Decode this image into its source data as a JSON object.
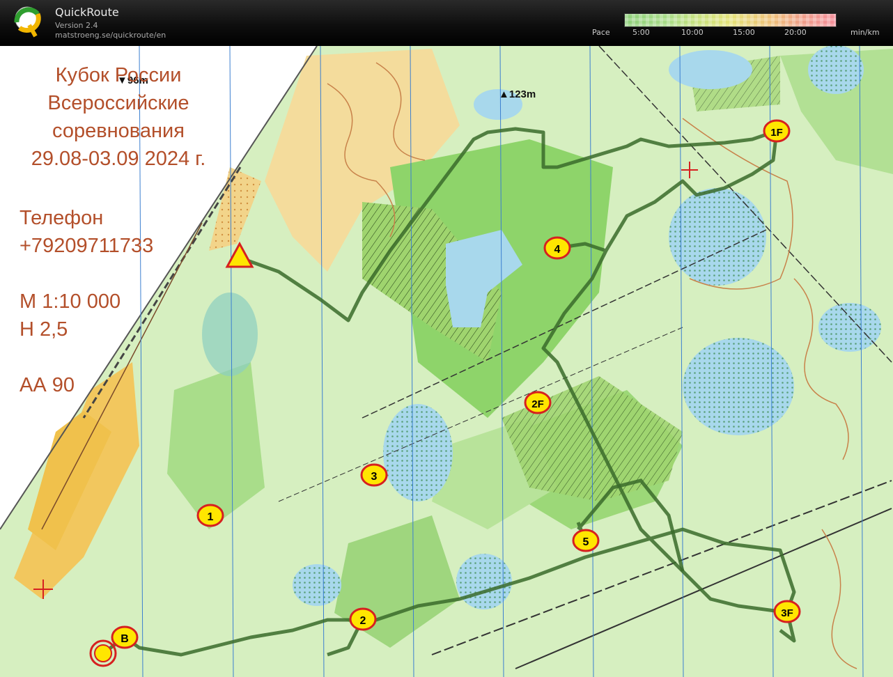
{
  "app": {
    "name": "QuickRoute",
    "version": "Version 2.4",
    "url": "matstroeng.se/quickroute/en"
  },
  "pace_scale": {
    "label": "Pace",
    "ticks": [
      "5:00",
      "10:00",
      "15:00",
      "20:00"
    ],
    "unit": "min/km",
    "colors": [
      "#8ed07a",
      "#c9e27e",
      "#e4e278",
      "#efc07a",
      "#f5909c"
    ]
  },
  "map_info": {
    "title_lines": [
      "Кубок России",
      "Всероссийские",
      "соревнования",
      "29.08-03.09 2024 г."
    ],
    "phone_label": "Телефон",
    "phone": "+79209711733",
    "scale": "М 1:10 000",
    "contour": "Н 2,5",
    "class": "АА 90"
  },
  "elevations": {
    "low": "96m",
    "high": "123m"
  },
  "controls": [
    "1",
    "2",
    "3",
    "4",
    "5",
    "1F",
    "2F",
    "3F",
    "B"
  ],
  "colors": {
    "route": "#3a6b2a",
    "control_fill": "#ffe600",
    "control_ring": "#d62020",
    "map_text": "#b34f2a"
  }
}
